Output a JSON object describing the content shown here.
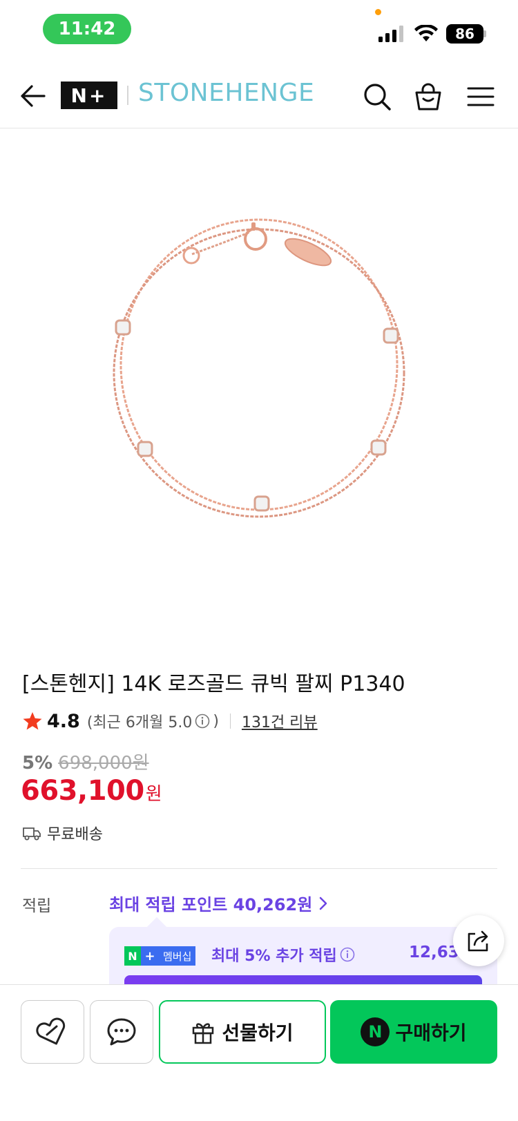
{
  "status_bar": {
    "time": "11:42",
    "battery": "86"
  },
  "header": {
    "logo_text": "N+",
    "brand": "STONEHENGE"
  },
  "product": {
    "title": "[스톤헨지] 14K 로즈골드 큐빅 팔찌 P1340",
    "rating": "4.8",
    "rating_recent_prefix": "(최근 6개월 5.0",
    "rating_recent_suffix": ")",
    "review_link": "131건 리뷰",
    "discount_rate": "5%",
    "original_price": "698,000원",
    "sale_price": "663,100",
    "sale_unit": "원",
    "shipping": "무료배송"
  },
  "points": {
    "label": "적립",
    "max_points": "최대 적립 포인트 40,262원",
    "membership_badge_n": "N",
    "membership_badge_plus": "+",
    "membership_badge_label": "멤버십",
    "membership_extra": "최대 5% 추가 적립",
    "membership_amount": "12,63"
  },
  "bottom_bar": {
    "gift_label": "선물하기",
    "npay_mark": "N",
    "buy_label": "구매하기"
  },
  "colors": {
    "naver_green": "#03c75a",
    "price_red": "#e0112b",
    "point_purple": "#6a43e3",
    "brand_teal": "#6cc3d3"
  }
}
